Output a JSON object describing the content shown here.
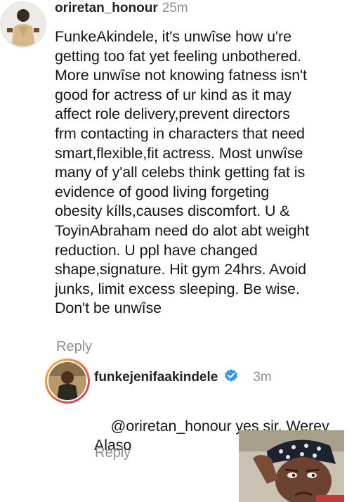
{
  "comment1": {
    "username": "oriretan_honour",
    "time": "25m",
    "text": "FunkeAkindele, it's unwîse how u're\ngetting too fat yet feeling unbothered.\nMore unwîse not knowing fatness isn't\ngood for actress of ur kind as it may\naffect role delivery,prevent directors\nfrm contacting in characters that need\nsmart,flexible,fit actress. Most unwîse\nmany of y'all celebs think getting fat is\nevidence of good living forgeting\nobesity kílls,causes discomfort. U &\nToyinAbraham need do alot abt weight\nreduction. U ppl have changed\nshape,signature. Hit gym 24hrs. Avoid\njunks, limit excess sleeping. Be wise.\nDon't be unwîse",
    "reply_label": "Reply",
    "avatar_icon": "person-avatar-icon"
  },
  "comment2": {
    "username": "funkejenifaakindele",
    "verified_icon": "verified-badge-icon",
    "time": "3m",
    "mention": "@oriretan_honour",
    "text": " yes sir. Werey\nAlaso",
    "reply_label": "Reply",
    "avatar_icon": "profile-photo-icon"
  },
  "meme": {
    "icon": "angry-woman-meme-icon"
  },
  "colors": {
    "text": "#161616",
    "muted": "#8e8e8e",
    "verified": "#3897f0"
  }
}
